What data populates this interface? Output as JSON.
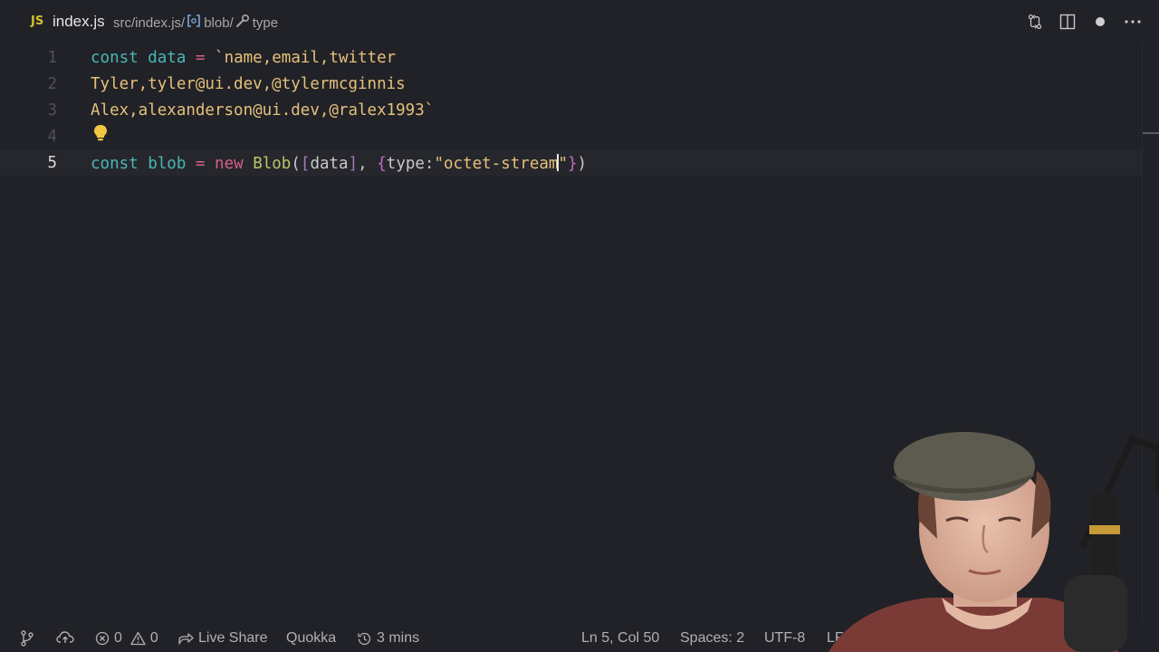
{
  "titlebar": {
    "lang_badge": "JS",
    "filename": "index.js",
    "breadcrumb": {
      "path": "src/index.js/",
      "item1": "blob/",
      "item2": "type"
    }
  },
  "editor": {
    "lines": [
      {
        "number": "1"
      },
      {
        "number": "2"
      },
      {
        "number": "3"
      },
      {
        "number": "4"
      },
      {
        "number": "5"
      }
    ],
    "code": {
      "l1_kw": "const",
      "l1_var": "data",
      "l1_eq": "=",
      "l1_str": "`name,email,twitter",
      "l2_str": "Tyler,tyler@ui.dev,@tylermcginnis",
      "l3_str": "Alex,alexanderson@ui.dev,@ralex1993`",
      "l5_kw": "const",
      "l5_var": "blob",
      "l5_eq": "=",
      "l5_new": "new",
      "l5_fn": "Blob",
      "l5_open_paren": "(",
      "l5_open_bracket": "[",
      "l5_arg": "data",
      "l5_close_bracket": "]",
      "l5_comma": ",",
      "l5_open_brace": "{",
      "l5_key": "type:",
      "l5_str_a": "\"octet-stream",
      "l5_str_b": "\"",
      "l5_close_brace": "}",
      "l5_close_paren": ")"
    }
  },
  "statusbar": {
    "errors": "0",
    "warnings": "0",
    "live_share": "Live Share",
    "quokka": "Quokka",
    "timer": "3 mins",
    "position": "Ln 5, Col 50",
    "spaces": "Spaces: 2",
    "encoding": "UTF-8",
    "eol": "LF"
  },
  "colors": {
    "background": "#212227",
    "keyword": "#48b7b8",
    "string": "#e5c07b",
    "operator": "#d65f8c",
    "function": "#b9c66b",
    "js_badge": "#d4c12b"
  }
}
